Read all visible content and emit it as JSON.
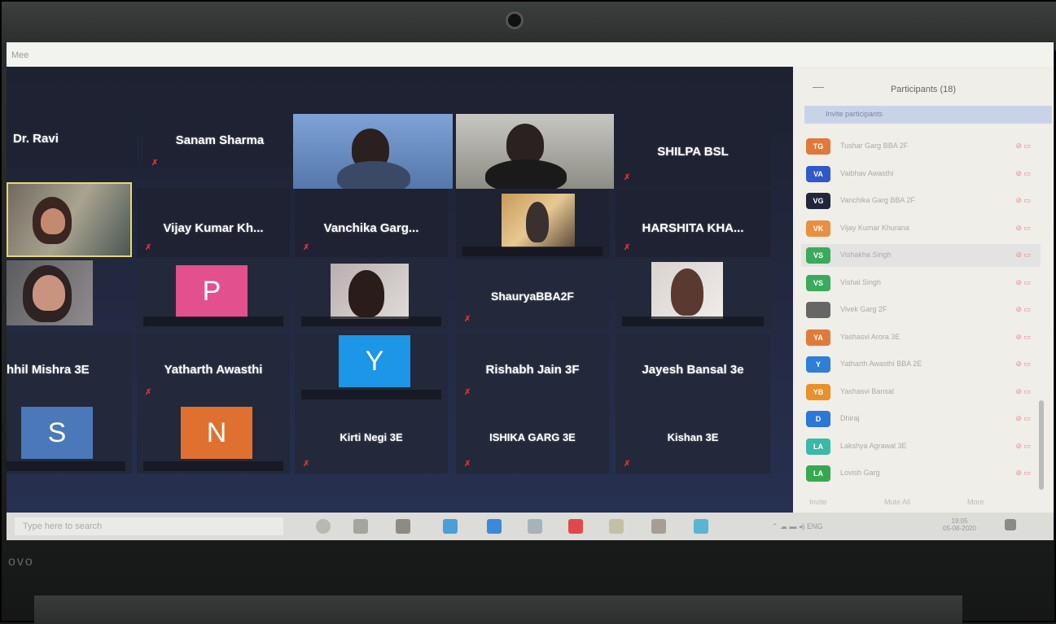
{
  "window": {
    "title_fragment": "Mee"
  },
  "gallery": {
    "tiles": [
      {
        "name": "Dr. Ravi",
        "muted": false
      },
      {
        "name": "Sanam Sharma",
        "muted": true
      },
      {
        "name": "Kirti Negi 3E",
        "muted": true
      },
      {
        "name": "ISHIKA GARG 3E",
        "muted": true
      },
      {
        "name": "Kishan 3E",
        "muted": true
      },
      {
        "name": "SHILPA BSL",
        "muted": true
      },
      {
        "name": "Vijay Kumar Kh...",
        "muted": true
      },
      {
        "name": "Vanchika Garg...",
        "muted": true
      },
      {
        "name": "HARSHITA KHA...",
        "muted": true
      },
      {
        "name": "ShauryaBBA2F",
        "muted": true
      },
      {
        "name": "hhil Mishra 3E",
        "muted": false
      },
      {
        "name": "Yatharth Awasthi",
        "muted": true
      },
      {
        "name": "Rishabh Jain 3F",
        "muted": true
      },
      {
        "name": "Jayesh Bansal 3e",
        "muted": true
      }
    ],
    "avatars": [
      {
        "letter": "P",
        "color": "#e2508e"
      },
      {
        "letter": "Y",
        "color": "#1c96e6"
      },
      {
        "letter": "S",
        "color": "#4a78b8"
      },
      {
        "letter": "N",
        "color": "#e07030"
      }
    ]
  },
  "participants_panel": {
    "title": "Participants (18)",
    "invite_text": "Invite participants",
    "rows": [
      {
        "initials": "TG",
        "color": "#e07a3a",
        "name": "Tushar Garg BBA 2F"
      },
      {
        "initials": "VA",
        "color": "#2f59c8",
        "name": "Vaibhav Awasthi"
      },
      {
        "initials": "VG",
        "color": "#20263c",
        "name": "Vanchika Garg BBA 2F"
      },
      {
        "initials": "VK",
        "color": "#e89040",
        "name": "Vijay Kumar Khurana"
      },
      {
        "initials": "VS",
        "color": "#3aab5c",
        "name": "Vishakha Singh",
        "highlighted": true
      },
      {
        "initials": "VS",
        "color": "#3aab5c",
        "name": "Vishal Singh"
      },
      {
        "initials": "",
        "color": "#666666",
        "name": "Vivek Garg 2F",
        "photo": true
      },
      {
        "initials": "YA",
        "color": "#e07a3a",
        "name": "Yashasvi Arora 3E"
      },
      {
        "initials": "Y",
        "color": "#2d7fd8",
        "name": "Yatharth Awasthi BBA 2E"
      },
      {
        "initials": "YB",
        "color": "#e8902a",
        "name": "Yashasvi Bansal"
      },
      {
        "initials": "D",
        "color": "#2a78d8",
        "name": "Dhiraj"
      },
      {
        "initials": "LA",
        "color": "#3ab8a8",
        "name": "Lakshya Agrawal 3E"
      },
      {
        "initials": "LA",
        "color": "#38a850",
        "name": "Lovish Garg"
      }
    ],
    "footer": {
      "invite": "Invite",
      "mute_all": "Mute All",
      "more": "More"
    }
  },
  "taskbar": {
    "search_placeholder": "Type here to search",
    "time": "19:05",
    "date": "05-08-2020"
  },
  "laptop": {
    "brand": "ovo"
  }
}
